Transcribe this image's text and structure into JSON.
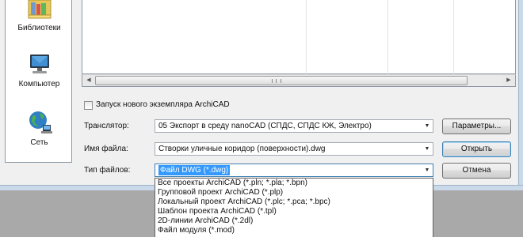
{
  "places": [
    {
      "label": "Библиотеки",
      "icon": "libraries-icon"
    },
    {
      "label": "Компьютер",
      "icon": "computer-icon"
    },
    {
      "label": "Сеть",
      "icon": "network-icon"
    }
  ],
  "options": {
    "new_instance_label": "Запуск нового экземпляра ArchiCAD",
    "new_instance_checked": false
  },
  "form": {
    "translator_label": "Транслятор:",
    "translator_value": "05 Экспорт в среду nanoCAD (СПДС, СПДС КЖ, Электро)",
    "filename_label": "Имя файла:",
    "filename_value": "Створки уличные коридор (поверхности).dwg",
    "filetype_label": "Тип файлов:",
    "filetype_value": "Файл DWG (*.dwg)"
  },
  "buttons": {
    "params": "Параметры...",
    "open": "Открыть",
    "cancel": "Отмена"
  },
  "filetype_options": [
    "Все проекты ArchiCAD (*.pln; *.pla; *.bpn)",
    "Групповой проект ArchiCAD (*.plp)",
    "Локальный проект ArchiCAD (*.plc; *.pca; *.bpc)",
    "Шаблон проекта ArchiCAD (*.tpl)",
    "2D-линии ArchiCAD (*.2dl)",
    "Файл модуля (*.mod)"
  ],
  "colors": {
    "selection": "#3399ff",
    "background_outside": "#a9a9a9",
    "dialog": "#f0f0f0"
  }
}
